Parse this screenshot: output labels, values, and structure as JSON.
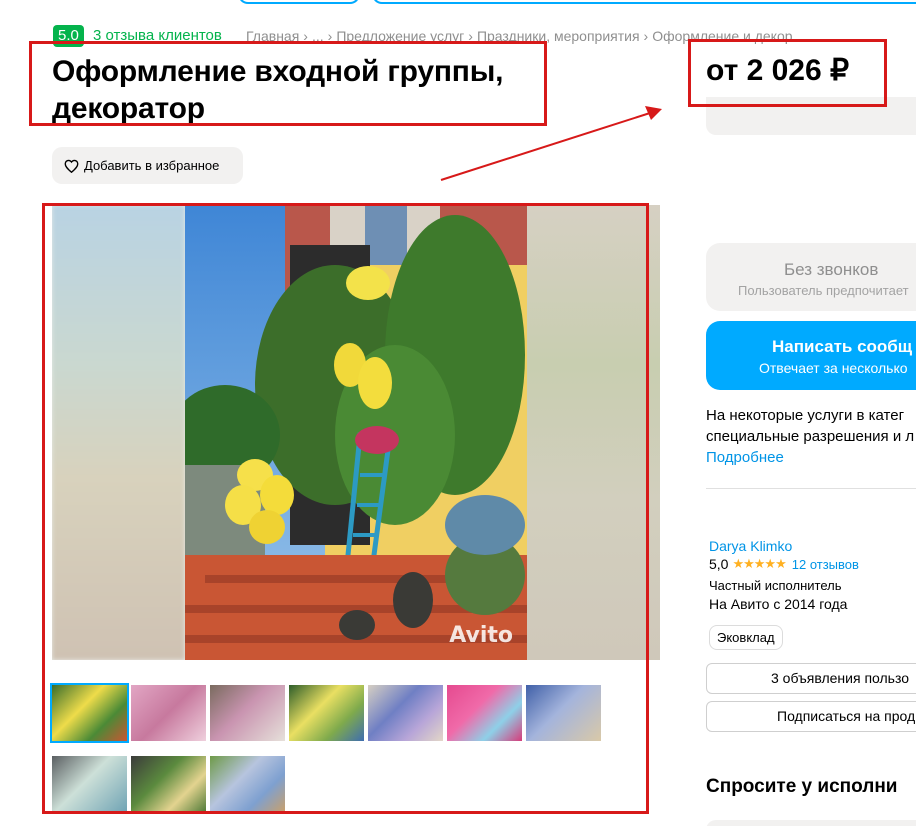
{
  "header": {
    "rating_value": "5.0",
    "reviews_link": "3 отзыва клиентов",
    "breadcrumbs": [
      "Главная",
      "...",
      "Предложение услуг",
      "Праздники, мероприятия",
      "Оформление и декор"
    ],
    "breadcrumb_separator": "›"
  },
  "listing": {
    "title": "Оформление входной группы, декоратор",
    "price": "от 2 026 ₽",
    "favorite_label": "Добавить в избранное",
    "watermark": "Avito",
    "thumbnail_count": 10,
    "active_thumbnail": 1
  },
  "sidebar": {
    "no_calls_title": "Без звонков",
    "no_calls_subtitle": "Пользователь предпочитает",
    "message_button": "Написать сообщ",
    "message_subtitle": "Отвечает за несколько",
    "notice_line1": "На некоторые услуги в катег",
    "notice_line2": "специальные разрешения и л",
    "notice_more": "Подробнее"
  },
  "seller": {
    "name": "Darya Klimko",
    "rating": "5,0",
    "stars": "★★★★★",
    "reviews": "12 отзывов",
    "type": "Частный исполнитель",
    "since": "На Авито с 2014 года",
    "tag": "Эковклад",
    "ads_button": "3 объявления пользо",
    "subscribe_button": "Подписаться на прод"
  },
  "ask": {
    "title": "Спросите у исполни"
  },
  "colors": {
    "accent_blue": "#00aaff",
    "rating_green": "#04b34c",
    "highlight_red": "#d71919",
    "link_blue": "#0094e6"
  }
}
